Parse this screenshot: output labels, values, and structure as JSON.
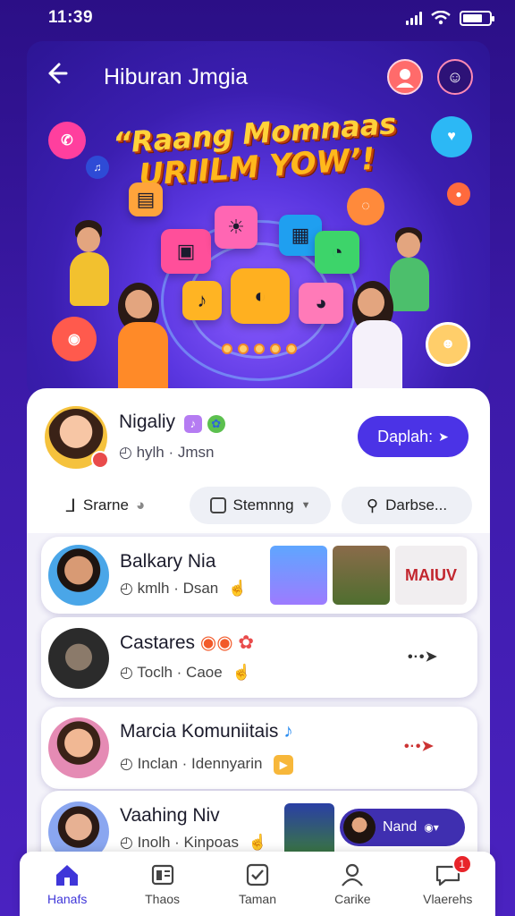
{
  "status_bar": {
    "time": "11:39",
    "battery_percent": 75
  },
  "header": {
    "title": "Hiburan Jmgia"
  },
  "hero": {
    "headline_line1": "“Raang Momnaas",
    "headline_line2": "URIILM YOW’!"
  },
  "profile": {
    "name": "Nigaliy",
    "meta": "hylh · Jmsn",
    "action_button": "Daplah:",
    "chips": [
      "Srarne",
      "Stemnng",
      "Darbse..."
    ]
  },
  "list": [
    {
      "title": "Balkary Nia",
      "meta": "kmlh · Dsan",
      "thumb_label": "MAIUV"
    },
    {
      "title": "Castares",
      "meta": "Toclh · Caoe"
    },
    {
      "title": "Marcia Komuniitais",
      "meta": "Inclan · Idennyarin"
    },
    {
      "title": "Vaahing Niv",
      "meta": "Inolh · Kinpoas",
      "pill_label": "Nand"
    }
  ],
  "bottom_nav": {
    "items": [
      {
        "label": "Hanafs",
        "icon": "home-icon"
      },
      {
        "label": "Thaos",
        "icon": "gallery-icon"
      },
      {
        "label": "Taman",
        "icon": "checkbox-icon"
      },
      {
        "label": "Carike",
        "icon": "people-icon"
      },
      {
        "label": "Vlaerehs",
        "icon": "chat-icon"
      }
    ],
    "notification_count": "1"
  },
  "colors": {
    "accent": "#4b33e6",
    "background": "#3a1a9a",
    "headline": "#ffd23a"
  }
}
